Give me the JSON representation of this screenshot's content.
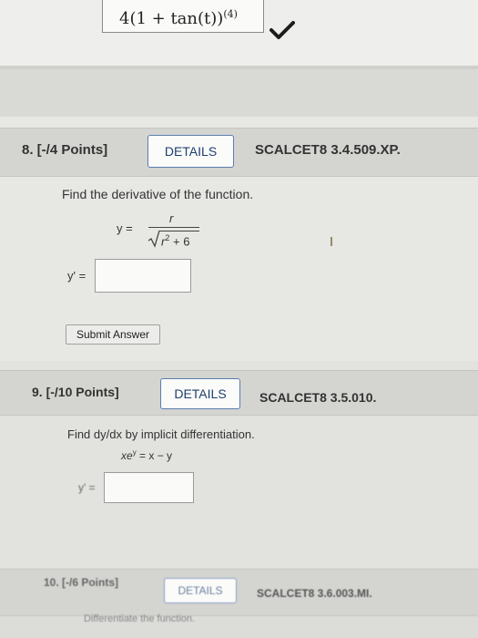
{
  "top": {
    "prev_answer": "4(1 + tan(t))",
    "prev_answer_exp": "(4)"
  },
  "q8": {
    "title": "8. [-/4 Points]",
    "details": "DETAILS",
    "code": "SCALCET8 3.4.509.XP.",
    "prompt": "Find the derivative of the function.",
    "lhs": "y =",
    "numerator": "r",
    "denominator": "r",
    "denominator_power": "2",
    "denominator_rest": "+ 6",
    "answer_label": "y' =",
    "answer_value": "",
    "submit": "Submit Answer"
  },
  "q9": {
    "title": "9. [-/10 Points]",
    "details": "DETAILS",
    "code": "SCALCET8 3.5.010.",
    "prompt": "Find dy/dx by implicit differentiation.",
    "equation_base": "xe",
    "equation_sup": "y",
    "equation_rest": "= x − y",
    "answer_label": "y' =",
    "answer_value": ""
  },
  "q10": {
    "title": "10. [-/6 Points]",
    "details": "DETAILS",
    "code": "SCALCET8 3.6.003.MI.",
    "prompt": "Differentiate the function."
  }
}
